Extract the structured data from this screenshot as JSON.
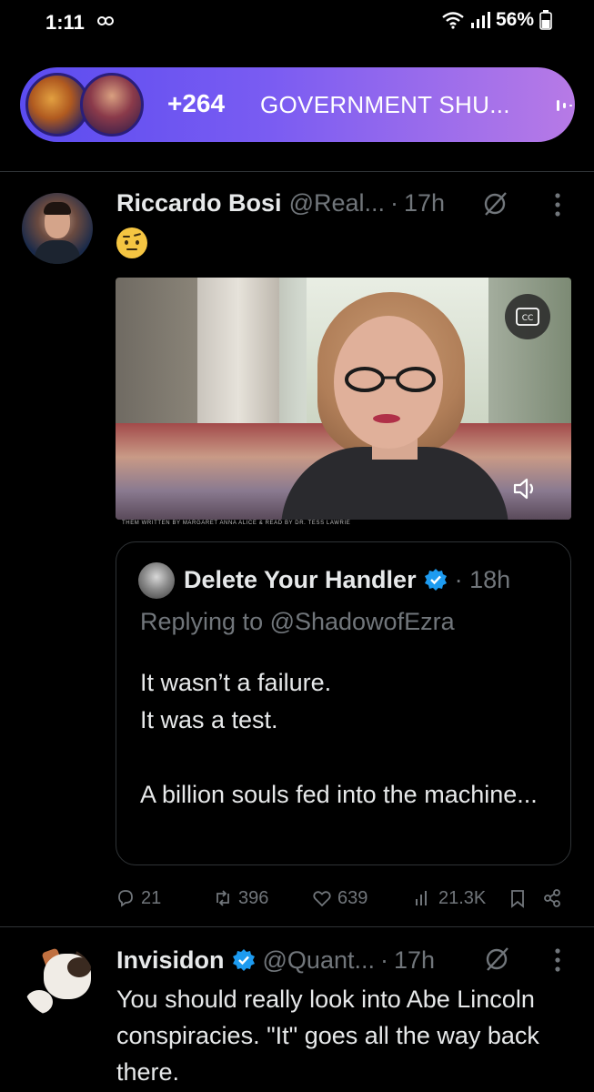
{
  "status_bar": {
    "time": "1:11",
    "battery": "56%"
  },
  "spaces": {
    "listener_count": "+264",
    "title": "GOVERNMENT SHU..."
  },
  "tweet1": {
    "author_name": "Riccardo Bosi",
    "handle": "@Real...",
    "separator": "·",
    "time": "17h",
    "video_credit": "THEM WRITTEN BY MARGARET ANNA ALICE & READ BY DR. TESS LAWRIE",
    "quote": {
      "author_name": "Delete Your Handler",
      "separator": "·",
      "time": "18h",
      "reply_to": "Replying to @ShadowofEzra",
      "text": "It wasn’t a failure.\nIt was a test.\n\nA billion souls fed into the machine..."
    },
    "actions": {
      "replies": "21",
      "reposts": "396",
      "likes": "639",
      "views": "21.3K"
    }
  },
  "tweet2": {
    "author_name": "Invisidon",
    "handle": "@Quant...",
    "separator": "·",
    "time": "17h",
    "text": "You should really look into Abe Lincoln conspiracies.  \"It\" goes all the way back there."
  },
  "colors": {
    "background": "#000000",
    "muted_text": "#71767b",
    "verified_blue": "#1d9bf0",
    "spaces_gradient_start": "#5b4cf0",
    "spaces_gradient_end": "#b77ae6"
  },
  "icons": [
    "link-icon",
    "wifi-icon",
    "signal-icon",
    "battery-icon",
    "audio-bars-icon",
    "grok-icon",
    "more-icon",
    "cc-icon",
    "volume-icon",
    "verified-icon",
    "reply-icon",
    "repost-icon",
    "like-icon",
    "views-icon",
    "bookmark-icon",
    "share-icon"
  ]
}
